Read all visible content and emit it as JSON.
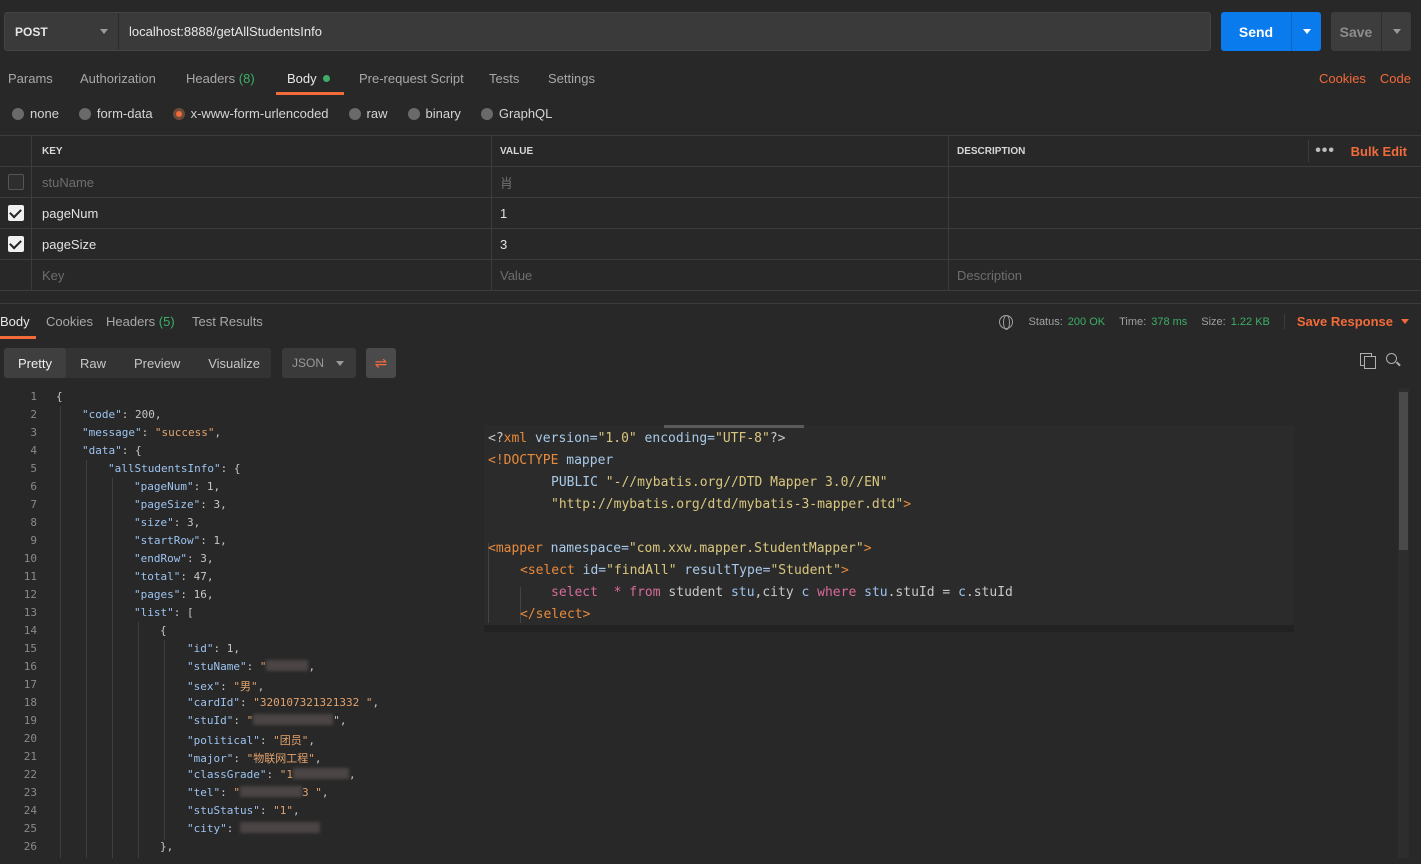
{
  "request": {
    "method": "POST",
    "url": "localhost:8888/getAllStudentsInfo",
    "send_label": "Send",
    "save_label": "Save"
  },
  "request_tabs": {
    "params": "Params",
    "authorization": "Authorization",
    "headers": "Headers",
    "headers_count": "(8)",
    "body": "Body",
    "prerequest": "Pre-request Script",
    "tests": "Tests",
    "settings": "Settings",
    "cookies": "Cookies",
    "code": "Code"
  },
  "body_types": [
    "none",
    "form-data",
    "x-www-form-urlencoded",
    "raw",
    "binary",
    "GraphQL"
  ],
  "body_type_selected": "x-www-form-urlencoded",
  "params": {
    "headers": {
      "key": "KEY",
      "value": "VALUE",
      "description": "DESCRIPTION",
      "bulk_edit": "Bulk Edit",
      "more": "•••"
    },
    "rows": [
      {
        "checked": false,
        "key": "stuName",
        "value": "肖",
        "description": ""
      },
      {
        "checked": true,
        "key": "pageNum",
        "value": "1",
        "description": ""
      },
      {
        "checked": true,
        "key": "pageSize",
        "value": "3",
        "description": ""
      }
    ],
    "placeholder": {
      "key": "Key",
      "value": "Value",
      "description": "Description"
    }
  },
  "response": {
    "tabs": {
      "body": "Body",
      "cookies": "Cookies",
      "headers": "Headers",
      "headers_count": "(5)",
      "test_results": "Test Results"
    },
    "status_label": "Status:",
    "status_value": "200 OK",
    "time_label": "Time:",
    "time_value": "378 ms",
    "size_label": "Size:",
    "size_value": "1.22 KB",
    "save_response": "Save Response",
    "views": {
      "pretty": "Pretty",
      "raw": "Raw",
      "preview": "Preview",
      "visualize": "Visualize"
    },
    "format": "JSON",
    "wrap_icon": "⇌"
  },
  "code_lines": [
    "1",
    "2",
    "3",
    "4",
    "5",
    "6",
    "7",
    "8",
    "9",
    "10",
    "11",
    "12",
    "13",
    "14",
    "15",
    "16",
    "17",
    "18",
    "19",
    "20",
    "21",
    "22",
    "23",
    "24",
    "25",
    "26"
  ],
  "json": {
    "code_key": "\"code\"",
    "code_val": "200",
    "message_key": "\"message\"",
    "message_val": "\"success\"",
    "data_key": "\"data\"",
    "asi_key": "\"allStudentsInfo\"",
    "pageNum_key": "\"pageNum\"",
    "pageNum_val": "1",
    "pageSize_key": "\"pageSize\"",
    "pageSize_val": "3",
    "size_key": "\"size\"",
    "size_val": "3",
    "startRow_key": "\"startRow\"",
    "startRow_val": "1",
    "endRow_key": "\"endRow\"",
    "endRow_val": "3",
    "total_key": "\"total\"",
    "total_val": "47",
    "pages_key": "\"pages\"",
    "pages_val": "16",
    "list_key": "\"list\"",
    "id_key": "\"id\"",
    "id_val": "1",
    "stuName_key": "\"stuName\"",
    "stuName_val": "\"",
    "sex_key": "\"sex\"",
    "sex_val": "\"男\"",
    "cardId_key": "\"cardId\"",
    "cardId_val": "\"320107321321332 \"",
    "stuId_key": "\"stuId\"",
    "stuId_val": "\"",
    "political_key": "\"political\"",
    "political_val": "\"团员\"",
    "major_key": "\"major\"",
    "major_val": "\"物联网工程\"",
    "classGrade_key": "\"classGrade\"",
    "classGrade_val": "\"1",
    "tel_key": "\"tel\"",
    "tel_val": "\"",
    "stuStatus_key": "\"stuStatus\"",
    "stuStatus_val": "\"1\"",
    "city_key": "\"city\""
  },
  "xml_overlay": {
    "l1_a": "<?",
    "l1_b": "xml",
    "l1_c": " version=",
    "l1_d": "\"1.0\"",
    "l1_e": " encoding=",
    "l1_f": "\"UTF-8\"",
    "l1_g": "?>",
    "l2_a": "<!DOCTYPE ",
    "l2_b": "mapper",
    "l3_a": "PUBLIC ",
    "l3_b": "\"-//mybatis.org//DTD Mapper 3.0//EN\"",
    "l4_a": "\"http://mybatis.org/dtd/mybatis-3-mapper.dtd\"",
    "l4_b": ">",
    "l5_a": "<",
    "l5_b": "mapper",
    "l5_c": " namespace=",
    "l5_d": "\"com.xxw.mapper.StudentMapper\"",
    "l5_e": ">",
    "l6_a": "<",
    "l6_b": "select",
    "l6_c": " id=",
    "l6_d": "\"findAll\"",
    "l6_e": " resultType=",
    "l6_f": "\"Student\"",
    "l6_g": ">",
    "l7_a": "select",
    "l7_b": "  * ",
    "l7_c": "from",
    "l7_d": " student ",
    "l7_e": "stu",
    "l7_f": ",city ",
    "l7_g": "c",
    "l7_h": " where ",
    "l7_i": "stu",
    "l7_j": ".stuId = ",
    "l7_k": "c",
    "l7_l": ".stuId",
    "l8_a": "</",
    "l8_b": "select",
    "l8_c": ">"
  }
}
